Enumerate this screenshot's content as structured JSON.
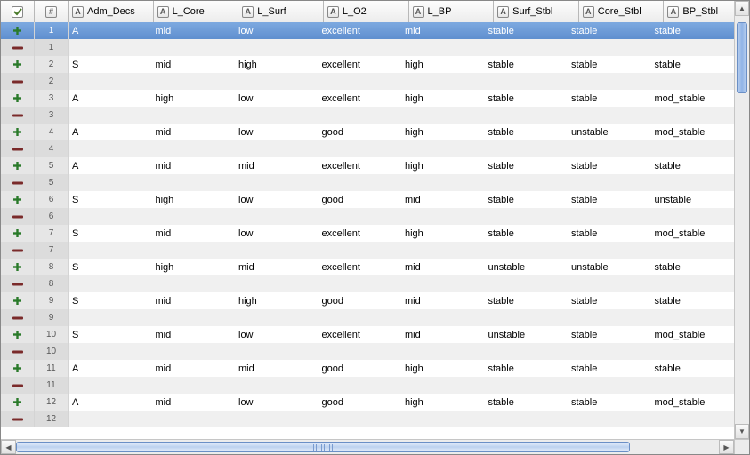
{
  "icons": {
    "attr_type": "A",
    "check": "✓",
    "hash": "#"
  },
  "columns": [
    "Adm_Decs",
    "L_Core",
    "L_Surf",
    "L_O2",
    "L_BP",
    "Surf_Stbl",
    "Core_Stbl",
    "BP_Stbl"
  ],
  "rows": [
    {
      "n": 1,
      "sel": true,
      "d": [
        "A",
        "mid",
        "low",
        "excellent",
        "mid",
        "stable",
        "stable",
        "stable"
      ]
    },
    {
      "n": 1,
      "d": null
    },
    {
      "n": 2,
      "d": [
        "S",
        "mid",
        "high",
        "excellent",
        "high",
        "stable",
        "stable",
        "stable"
      ]
    },
    {
      "n": 2,
      "d": null
    },
    {
      "n": 3,
      "d": [
        "A",
        "high",
        "low",
        "excellent",
        "high",
        "stable",
        "stable",
        "mod_stable"
      ]
    },
    {
      "n": 3,
      "d": null
    },
    {
      "n": 4,
      "d": [
        "A",
        "mid",
        "low",
        "good",
        "high",
        "stable",
        "unstable",
        "mod_stable"
      ]
    },
    {
      "n": 4,
      "d": null
    },
    {
      "n": 5,
      "d": [
        "A",
        "mid",
        "mid",
        "excellent",
        "high",
        "stable",
        "stable",
        "stable"
      ]
    },
    {
      "n": 5,
      "d": null
    },
    {
      "n": 6,
      "d": [
        "S",
        "high",
        "low",
        "good",
        "mid",
        "stable",
        "stable",
        "unstable"
      ]
    },
    {
      "n": 6,
      "d": null
    },
    {
      "n": 7,
      "d": [
        "S",
        "mid",
        "low",
        "excellent",
        "high",
        "stable",
        "stable",
        "mod_stable"
      ]
    },
    {
      "n": 7,
      "d": null
    },
    {
      "n": 8,
      "d": [
        "S",
        "high",
        "mid",
        "excellent",
        "mid",
        "unstable",
        "unstable",
        "stable"
      ]
    },
    {
      "n": 8,
      "d": null
    },
    {
      "n": 9,
      "d": [
        "S",
        "mid",
        "high",
        "good",
        "mid",
        "stable",
        "stable",
        "stable"
      ]
    },
    {
      "n": 9,
      "d": null
    },
    {
      "n": 10,
      "d": [
        "S",
        "mid",
        "low",
        "excellent",
        "mid",
        "unstable",
        "stable",
        "mod_stable"
      ]
    },
    {
      "n": 10,
      "d": null
    },
    {
      "n": 11,
      "d": [
        "A",
        "mid",
        "mid",
        "good",
        "high",
        "stable",
        "stable",
        "stable"
      ]
    },
    {
      "n": 11,
      "d": null
    },
    {
      "n": 12,
      "d": [
        "A",
        "mid",
        "low",
        "good",
        "high",
        "stable",
        "stable",
        "mod_stable"
      ]
    },
    {
      "n": 12,
      "d": null
    }
  ]
}
